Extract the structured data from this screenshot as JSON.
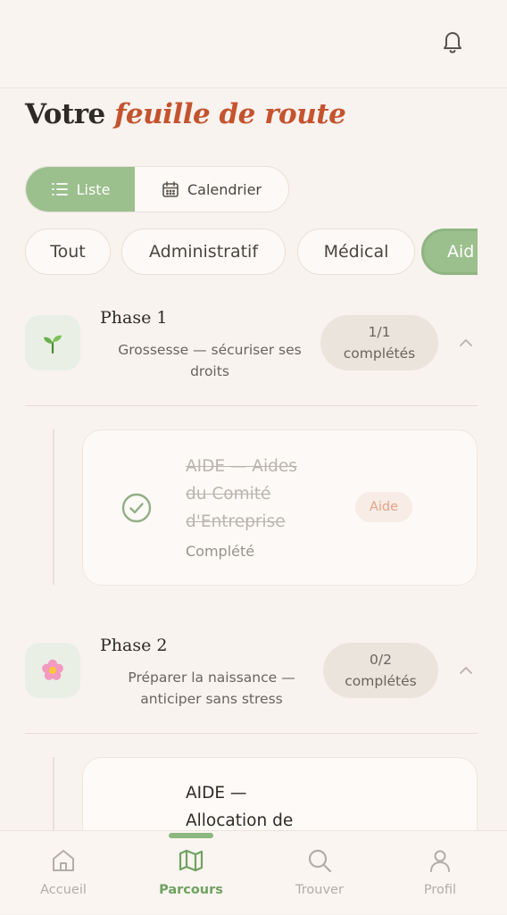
{
  "header": {
    "title_prefix": "Votre",
    "title_accent": "feuille de route"
  },
  "view_toggle": {
    "list_label": "Liste",
    "calendar_label": "Calendrier",
    "selected": "Liste"
  },
  "filters": [
    "Tout",
    "Administratif",
    "Médical",
    "Aid"
  ],
  "phases": [
    {
      "name": "Phase 1",
      "subtitle_line1": "Grossesse — sécuriser ses",
      "subtitle_line2": "droits",
      "count": "1/1",
      "count_label": "complétés",
      "icon": "seedling-icon",
      "items": [
        {
          "title_lines": [
            "AIDE — Aides",
            "du Comité",
            "d'Entreprise"
          ],
          "status": "Complété",
          "tag": "Aide",
          "completed": true
        }
      ]
    },
    {
      "name": "Phase 2",
      "subtitle_line1": "Préparer la naissance —",
      "subtitle_line2": "anticiper sans stress",
      "count": "0/2",
      "count_label": "complétés",
      "icon": "blossom-icon",
      "items": [
        {
          "title_lines": [
            "AIDE —",
            "Allocation de"
          ],
          "completed": false
        }
      ]
    }
  ],
  "nav": [
    {
      "label": "Accueil",
      "icon": "home-icon"
    },
    {
      "label": "Parcours",
      "icon": "map-icon",
      "active": true
    },
    {
      "label": "Trouver",
      "icon": "search-icon"
    },
    {
      "label": "Profil",
      "icon": "user-icon"
    }
  ],
  "colors": {
    "accent": "#c4532e",
    "green": "#9bbf8d",
    "tag_text": "#e39b7e"
  }
}
